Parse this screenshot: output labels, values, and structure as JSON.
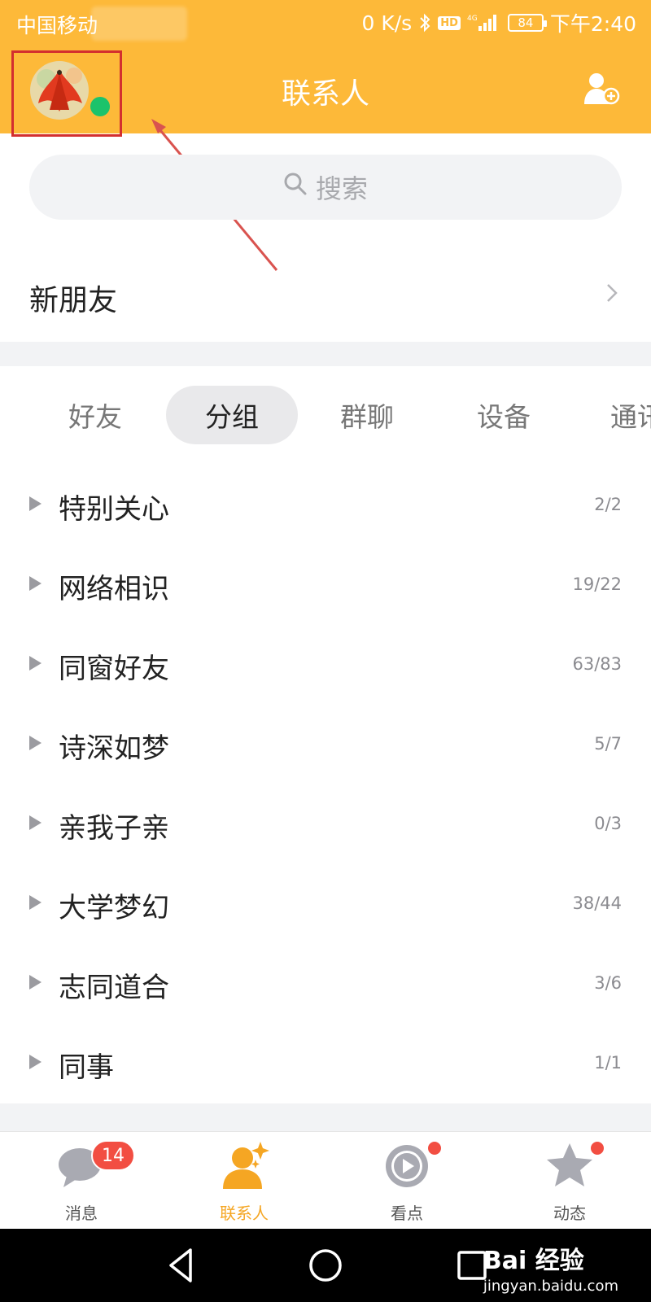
{
  "status_bar": {
    "carrier": "中国移动",
    "net_speed": "0 K/s",
    "hd_label": "HD",
    "network_type": "4G",
    "battery": "84",
    "time": "下午2:40"
  },
  "header": {
    "title": "联系人"
  },
  "search": {
    "placeholder": "搜索"
  },
  "new_friend": {
    "label": "新朋友"
  },
  "tabs": [
    {
      "label": "好友",
      "active": false
    },
    {
      "label": "分组",
      "active": true
    },
    {
      "label": "群聊",
      "active": false
    },
    {
      "label": "设备",
      "active": false
    },
    {
      "label": "通讯录",
      "active": false
    }
  ],
  "groups": [
    {
      "name": "特别关心",
      "count": "2/2"
    },
    {
      "name": "网络相识",
      "count": "19/22"
    },
    {
      "name": "同窗好友",
      "count": "63/83"
    },
    {
      "name": "诗深如梦",
      "count": "5/7"
    },
    {
      "name": "亲我子亲",
      "count": "0/3"
    },
    {
      "name": "大学梦幻",
      "count": "38/44"
    },
    {
      "name": "志同道合",
      "count": "3/6"
    },
    {
      "name": "同事",
      "count": "1/1"
    }
  ],
  "bottom_nav": [
    {
      "label": "消息",
      "badge": "14",
      "icon": "chat-bubble-icon",
      "active": false
    },
    {
      "label": "联系人",
      "icon": "contacts-person-icon",
      "active": true
    },
    {
      "label": "看点",
      "icon": "play-circle-icon",
      "active": false,
      "dot": true
    },
    {
      "label": "动态",
      "icon": "star-icon",
      "active": false,
      "dot": true
    }
  ],
  "watermark": {
    "main": "Bai 经验",
    "sub": "jingyan.baidu.com"
  },
  "colors": {
    "header": "#FDB939",
    "accent": "#F5A623",
    "online": "#1CC36B",
    "badge": "#F24E42",
    "highlight_box": "#D32F2F"
  }
}
